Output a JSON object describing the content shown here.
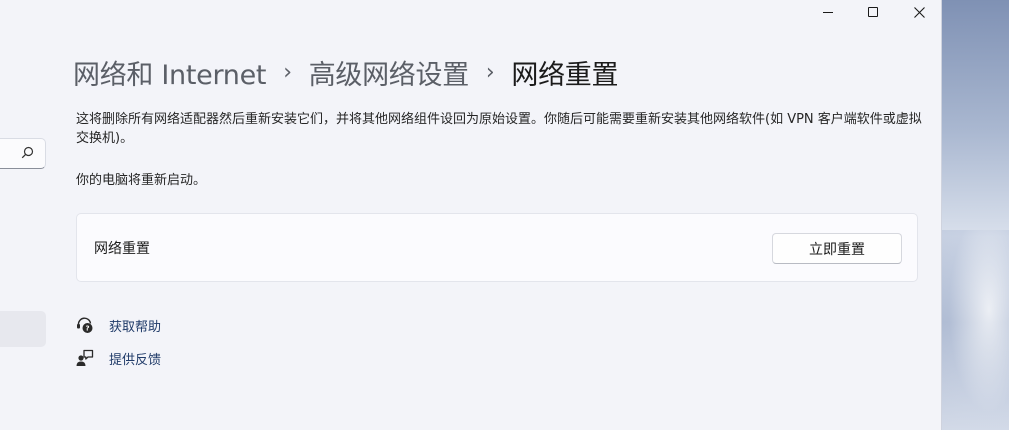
{
  "window": {
    "caption_buttons": [
      "minimize",
      "maximize",
      "close"
    ]
  },
  "breadcrumb": {
    "items": [
      "网络和 Internet",
      "高级网络设置"
    ],
    "current": "网络重置",
    "separator": "›"
  },
  "description": "这将删除所有网络适配器然后重新安装它们，并将其他网络组件设回为原始设置。你随后可能需要重新安装其他网络软件(如 VPN 客户端软件或虚拟交换机)。",
  "restart_note": "你的电脑将重新启动。",
  "reset_card": {
    "label": "网络重置",
    "button_label": "立即重置"
  },
  "links": {
    "help": "获取帮助",
    "feedback": "提供反馈"
  },
  "icons": {
    "sidebar_search": "search-icon",
    "help": "help-icon",
    "feedback": "feedback-icon"
  },
  "colors": {
    "window_bg": "#f3f4f9",
    "card_bg": "#fbfbfe",
    "link": "#1f3a68"
  }
}
